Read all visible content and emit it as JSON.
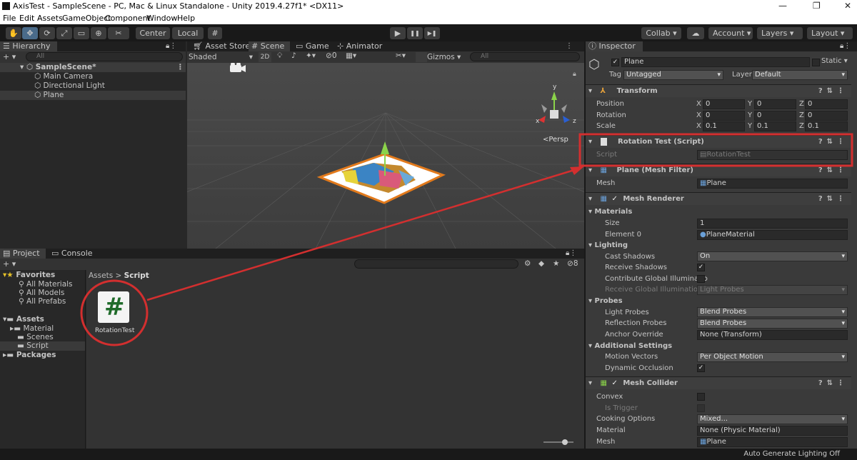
{
  "window": {
    "title": "AxisTest - SampleScene - PC, Mac & Linux Standalone - Unity 2019.4.27f1* <DX11>",
    "minimize": "—",
    "restore": "❐",
    "close": "✕"
  },
  "menu": [
    "File",
    "Edit",
    "Assets",
    "GameObject",
    "Component",
    "Window",
    "Help"
  ],
  "toolbar": {
    "tools": [
      "hand-icon",
      "move-icon",
      "rotate-icon",
      "scale-icon",
      "rect-icon",
      "transform-icon",
      "custom-tool-icon"
    ],
    "pivot": "Center",
    "space": "Local",
    "play": "▶",
    "pause": "❚❚",
    "step": "▶❚",
    "collab": "Collab ▾",
    "account": "Account",
    "layers": "Layers",
    "layout": "Layout"
  },
  "hierarchy": {
    "tab": "Hierarchy",
    "add": "+ ▾",
    "search": "All",
    "scene": "SampleScene*",
    "items": [
      "Main Camera",
      "Directional Light",
      "Plane"
    ]
  },
  "scene": {
    "tabs": [
      "Asset Store",
      "Scene",
      "Game",
      "Animator"
    ],
    "shading": "Shaded",
    "mode2d": "2D",
    "fx_count": "0",
    "gizmos": "Gizmos",
    "search": "All",
    "persp": "<Persp",
    "axes": {
      "y": "y",
      "x": "x",
      "z": "z"
    }
  },
  "project": {
    "tabs": [
      "Project",
      "Console"
    ],
    "add": "+ ▾",
    "breadcrumb": {
      "root": "Assets",
      "sep": ">",
      "leaf": "Script"
    },
    "hidden_count": "8",
    "favorites": {
      "label": "Favorites",
      "items": [
        "All Materials",
        "All Models",
        "All Prefabs"
      ]
    },
    "assets": {
      "label": "Assets",
      "items": [
        "Material",
        "Scenes",
        "Script"
      ]
    },
    "packages": "Packages",
    "file": {
      "name": "RotationTest",
      "glyph": "#"
    }
  },
  "inspector": {
    "tab": "Inspector",
    "object_name": "Plane",
    "static_label": "Static",
    "tag_label": "Tag",
    "tag_value": "Untagged",
    "layer_label": "Layer",
    "layer_value": "Default",
    "transform": {
      "title": "Transform",
      "rows": [
        {
          "label": "Position",
          "x": "0",
          "y": "0",
          "z": "0"
        },
        {
          "label": "Rotation",
          "x": "0",
          "y": "0",
          "z": "0"
        },
        {
          "label": "Scale",
          "x": "0.1",
          "y": "0.1",
          "z": "0.1"
        }
      ],
      "axis_x": "X",
      "axis_y": "Y",
      "axis_z": "Z"
    },
    "script_comp": {
      "title": "Rotation Test (Script)",
      "label": "Script",
      "value": "RotationTest"
    },
    "mesh_filter": {
      "title": "Plane (Mesh Filter)",
      "label": "Mesh",
      "value": "Plane"
    },
    "mesh_renderer": {
      "title": "Mesh Renderer",
      "materials": "Materials",
      "size_label": "Size",
      "size_value": "1",
      "element_label": "Element 0",
      "element_value": "PlaneMaterial",
      "lighting": "Lighting",
      "cast_label": "Cast Shadows",
      "cast_value": "On",
      "receive_label": "Receive Shadows",
      "contribute_label": "Contribute Global Illuminatio",
      "rgi_label": "Receive Global Illumination",
      "rgi_value": "Light Probes",
      "probes": "Probes",
      "light_probes_label": "Light Probes",
      "light_probes_value": "Blend Probes",
      "refl_label": "Reflection Probes",
      "refl_value": "Blend Probes",
      "anchor_label": "Anchor Override",
      "anchor_value": "None (Transform)",
      "additional": "Additional Settings",
      "motion_label": "Motion Vectors",
      "motion_value": "Per Object Motion",
      "occlusion_label": "Dynamic Occlusion"
    },
    "mesh_collider": {
      "title": "Mesh Collider",
      "convex": "Convex",
      "trigger": "Is Trigger",
      "cooking_label": "Cooking Options",
      "cooking_value": "Mixed...",
      "material_label": "Material",
      "material_value": "None (Physic Material)",
      "mesh_label": "Mesh",
      "mesh_value": "Plane"
    }
  },
  "status": {
    "text": "Auto Generate Lighting Off"
  },
  "colors": {
    "highlight": "#d32f2f",
    "selection": "#4a6b8a"
  }
}
